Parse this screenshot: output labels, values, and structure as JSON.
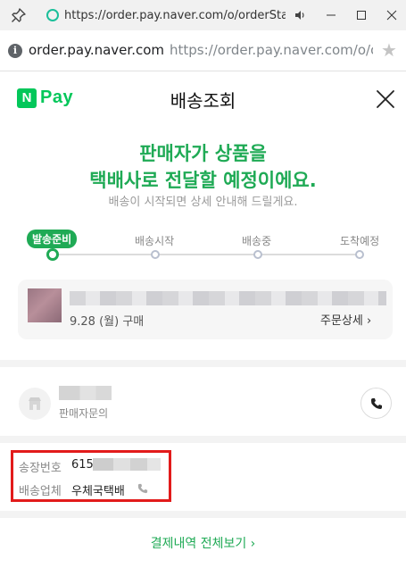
{
  "window": {
    "title_url": "https://order.pay.naver.com/o/orderStatus..."
  },
  "address_bar": {
    "domain": "order.pay.naver.com",
    "full_url": "https://order.pay.naver.com/o/orderStatus/..."
  },
  "header": {
    "logo_mark": "N",
    "logo_text": "Pay",
    "title": "배송조회"
  },
  "status": {
    "headline_line1": "판매자가 상품을",
    "headline_line2": "택배사로 전달할 예정이에요.",
    "subline": "배송이 시작되면 상세 안내해 드릴게요."
  },
  "steps": [
    {
      "label": "발송준비",
      "active": true
    },
    {
      "label": "배송시작",
      "active": false
    },
    {
      "label": "배송중",
      "active": false
    },
    {
      "label": "도착예정",
      "active": false
    }
  ],
  "order": {
    "date": "9.28 (월) 구매",
    "detail_link": "주문상세",
    "detail_chevron": "›"
  },
  "seller": {
    "inquiry_label": "판매자문의"
  },
  "shipping": {
    "tracking_label": "송장번호",
    "tracking_prefix": "615",
    "carrier_label": "배송업체",
    "carrier_name": "우체국택배"
  },
  "footer": {
    "payment_link": "결제내역 전체보기",
    "payment_chevron": "›"
  },
  "colors": {
    "brand_green": "#03c75a",
    "accent_green": "#1faa55",
    "highlight_red": "#e21b1b"
  },
  "icons": [
    "pin-icon",
    "site-circle-icon",
    "mute-icon",
    "minimize-icon",
    "maximize-icon",
    "close-window-icon",
    "info-icon",
    "star-icon",
    "close-icon",
    "store-icon",
    "phone-icon",
    "carrier-phone-icon"
  ]
}
